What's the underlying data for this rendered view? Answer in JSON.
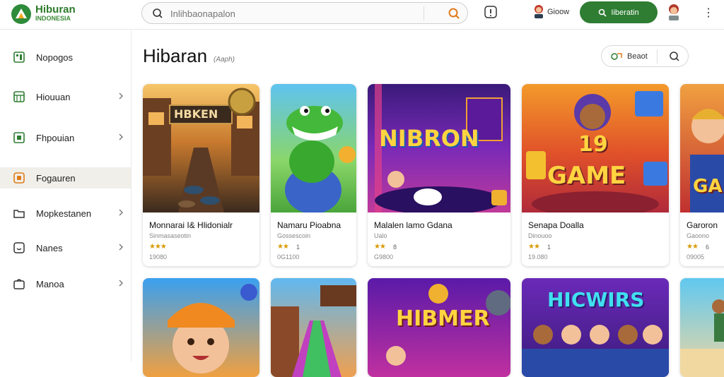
{
  "header": {
    "brand_title": "Hiburan",
    "brand_sub": "INDONESIA",
    "search_placeholder": "Inlihbaonapalon",
    "user_name": "Gioow",
    "signin_label": "Iiberatin"
  },
  "sidebar": {
    "items": [
      {
        "label": "Nopogos",
        "chevron": false
      },
      {
        "label": "Hiouuan",
        "chevron": true
      },
      {
        "label": "Fhpouian",
        "chevron": true
      },
      {
        "label": "Fogauren",
        "chevron": false
      },
      {
        "label": "Mopkestanen",
        "chevron": true
      },
      {
        "label": "Nanes",
        "chevron": true
      },
      {
        "label": "Manoa",
        "chevron": true
      }
    ]
  },
  "main": {
    "title": "Hibaran",
    "subtitle": "(Aaph)",
    "filter_label": "Beaot"
  },
  "cards": [
    {
      "title": "Monnarai I& Hlidonialr",
      "sub": "Sinmasaseotin",
      "stars": "★★★",
      "rating": "",
      "plays": "19080",
      "thumb_text": "HBKEN"
    },
    {
      "title": "Namaru Pioabna",
      "sub": "Gossescoin",
      "stars": "★★",
      "rating": "1",
      "plays": "0G1100",
      "thumb_text": ""
    },
    {
      "title": "Malalen lamo Gdana",
      "sub": "Ualo",
      "stars": "★★",
      "rating": "8",
      "plays": "G9800",
      "thumb_text": "NIBRON"
    },
    {
      "title": "Senapa Doalla",
      "sub": "Dinouoo",
      "stars": "★★",
      "rating": "1",
      "plays": "19.080",
      "thumb_text_a": "19",
      "thumb_text_b": "GAME"
    },
    {
      "title": "Garoron",
      "sub": "Gaoono",
      "stars": "★★",
      "rating": "6",
      "plays": "09005",
      "thumb_text": "GA"
    }
  ],
  "cards_row2": [
    {
      "thumb_text": ""
    },
    {
      "thumb_text": ""
    },
    {
      "thumb_text": "HIBMER"
    },
    {
      "thumb_text": "HICWIRS"
    },
    {
      "thumb_text": ""
    }
  ],
  "colors": {
    "accent": "#2e7d32",
    "star": "#d89a00",
    "active_bg": "#f1efe9"
  }
}
